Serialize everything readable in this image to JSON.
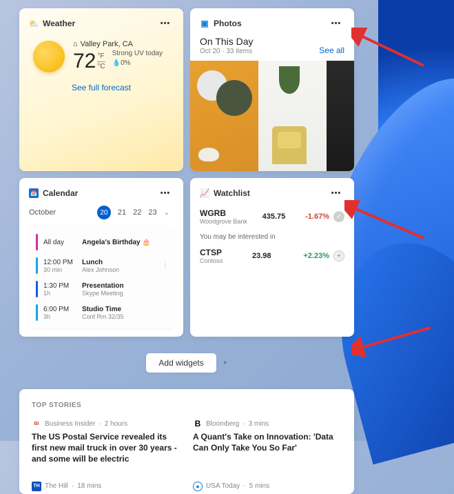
{
  "weather": {
    "title": "Weather",
    "location": "Valley Park, CA",
    "temp": "72",
    "unit_f": "°F",
    "unit_c": "°C",
    "cond": "Strong UV today",
    "humidity": "0%",
    "link": "See full forecast"
  },
  "photos": {
    "title": "Photos",
    "heading": "On This Day",
    "sub": "Oct 20 · 33 items",
    "see_all": "See all"
  },
  "calendar": {
    "title": "Calendar",
    "month": "October",
    "days": {
      "active": "20",
      "d1": "21",
      "d2": "22",
      "d3": "23"
    },
    "events": [
      {
        "color": "#d030a0",
        "time": "All day",
        "dur": "",
        "title": "Angela's Birthday 🎂",
        "sub": ""
      },
      {
        "color": "#10a8e8",
        "time": "12:00 PM",
        "dur": "30 min",
        "title": "Lunch",
        "sub": "Alex Johnson"
      },
      {
        "color": "#1060d8",
        "time": "1:30 PM",
        "dur": "1h",
        "title": "Presentation",
        "sub": "Skype Meeting"
      },
      {
        "color": "#10a8e8",
        "time": "6:00 PM",
        "dur": "3h",
        "title": "Studio Time",
        "sub": "Conf Rm 32/35"
      }
    ]
  },
  "watchlist": {
    "title": "Watchlist",
    "rows": [
      {
        "sym": "WGRB",
        "name": "Woodgrove Bank",
        "price": "435.75",
        "change": "-1.67%",
        "dir": "neg"
      }
    ],
    "interest_label": "You may be interested in",
    "suggest": [
      {
        "sym": "CTSP",
        "name": "Contoso",
        "price": "23.98",
        "change": "+2.23%",
        "dir": "pos"
      }
    ]
  },
  "add_widgets": "Add widgets",
  "news": {
    "header": "TOP STORIES",
    "items": [
      {
        "src": "Business Insider",
        "time": "2 hours",
        "icon_bg": "#fff",
        "icon_fg": "#d04040",
        "icon": "BI",
        "title": "The US Postal Service revealed its first new mail truck in over 30 years - and some will be electric"
      },
      {
        "src": "Bloomberg",
        "time": "3 mins",
        "icon_bg": "#fff",
        "icon_fg": "#000",
        "icon": "B",
        "title": "A Quant's Take on Innovation: 'Data Can Only Take You So Far'"
      },
      {
        "src": "The Hill",
        "time": "18 mins",
        "icon_bg": "#1050c0",
        "icon_fg": "#fff",
        "icon": "TH",
        "title": ""
      },
      {
        "src": "USA Today",
        "time": "5 mins",
        "icon_bg": "#fff",
        "icon_fg": "#1080e0",
        "icon": "●",
        "title": ""
      }
    ]
  }
}
